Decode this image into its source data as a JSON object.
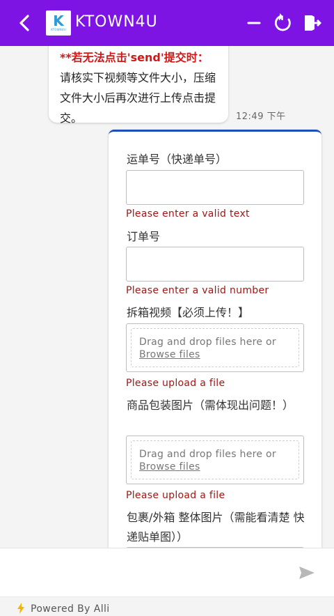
{
  "header": {
    "title": "KTOWN4U",
    "logo_letter": "K",
    "logo_text": "KTOWN4U",
    "accent": "#7d14e4"
  },
  "chat": {
    "incoming": {
      "warning": "**若无法点击'send'提交时：",
      "body": "请核实下视频等文件大小，压缩文件大小后再次进行上传点击提交。"
    },
    "time": "12:49 下午"
  },
  "form": {
    "field1_label": "运单号（快递单号）",
    "field1_error": "Please enter a valid text",
    "field2_label": "订单号",
    "field2_error": "Please enter a valid number",
    "field3_label": "拆箱视频【必须上传！】",
    "field3_drop": "Drag and drop files here or",
    "field3_browse": "Browse files",
    "field3_error": "Please upload a file",
    "field4_label": "商品包装图片（需体现出问题！）",
    "field4_drop": "Drag and drop files here or",
    "field4_browse": "Browse files",
    "field4_error": "Please upload a file",
    "field5_label": "包裹/外箱 整体图片（需能看清楚 快递贴单图））"
  },
  "footer": {
    "powered": "Powered By Alli"
  },
  "icons": {
    "back": "chevron-left-icon",
    "minimize": "minus-icon",
    "new_chat": "refresh-new-icon",
    "exit": "exit-door-icon",
    "send": "send-icon",
    "bolt": "bolt-icon"
  }
}
